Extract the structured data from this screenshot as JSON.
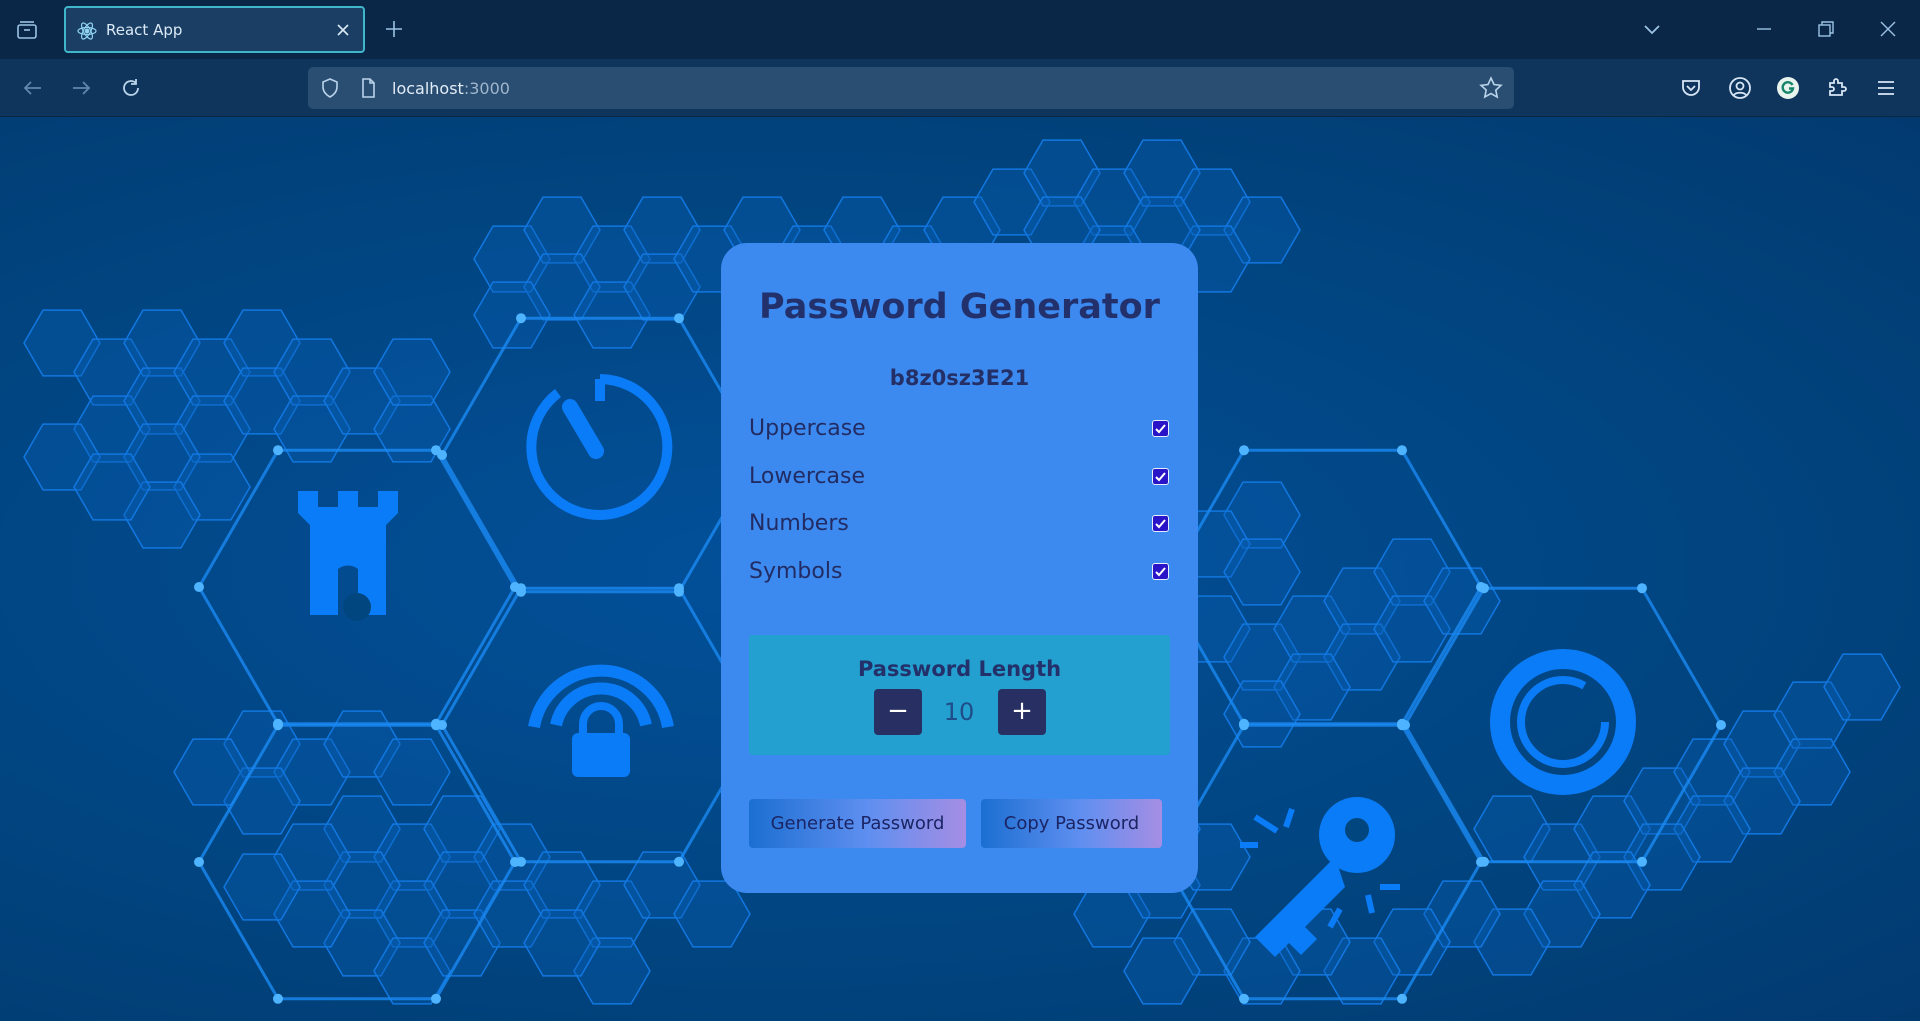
{
  "browser": {
    "tab_title": "React App",
    "url_host": "localhost",
    "url_port": ":3000",
    "icons": {
      "tab_overview": "folder-tabs-icon",
      "tab_favicon": "react-atom-icon",
      "tab_close": "close-icon",
      "new_tab": "plus-icon",
      "tab_list": "chevron-down-icon",
      "back": "arrow-left-icon",
      "forward": "arrow-right-icon",
      "reload": "reload-icon",
      "tracking_shield": "shield-icon",
      "page_info": "page-icon",
      "bookmark": "star-icon",
      "pocket": "pocket-icon",
      "account": "account-icon",
      "grammarly": "grammarly-icon",
      "extensions": "puzzle-icon",
      "menu": "hamburger-menu-icon"
    }
  },
  "app": {
    "title": "Password Generator",
    "password": "b8z0sz3E21",
    "options": [
      {
        "label": "Uppercase",
        "checked": true
      },
      {
        "label": "Lowercase",
        "checked": true
      },
      {
        "label": "Numbers",
        "checked": true
      },
      {
        "label": "Symbols",
        "checked": true
      }
    ],
    "length": {
      "label": "Password Length",
      "decrement": "−",
      "value": "10",
      "increment": "+"
    },
    "generate_label": "Generate Password",
    "copy_label": "Copy Password"
  },
  "colors": {
    "page_bg": "#014a8a",
    "card_bg": "#3c8af0",
    "length_box_bg": "#23a0cf",
    "stepper_bg": "#272f63",
    "checkbox": "#2a14c8",
    "hex_accent": "#0a7cf0"
  }
}
